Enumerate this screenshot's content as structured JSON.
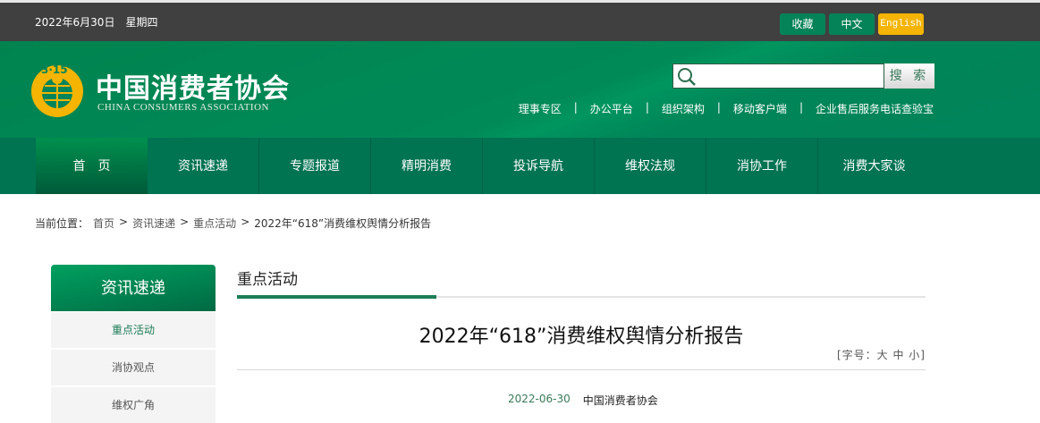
{
  "topbar": {
    "date": "2022年6月30日　星期四",
    "favorite": "收藏",
    "chinese": "中文",
    "english": "English"
  },
  "header": {
    "logo_cn": "中国消费者协会",
    "logo_en": "CHINA CONSUMERS ASSOCIATION",
    "logo_badge": "3·15",
    "search_placeholder": "",
    "search_button": "搜 索",
    "links": [
      "理事专区",
      "办公平台",
      "组织架构",
      "移动客户端",
      "企业售后服务电话查验宝"
    ]
  },
  "nav": [
    "首　页",
    "资讯速递",
    "专题报道",
    "精明消费",
    "投诉导航",
    "维权法规",
    "消协工作",
    "消费大家谈"
  ],
  "breadcrumb": {
    "label": "当前位置：",
    "items": [
      "首页",
      "资讯速递",
      "重点活动",
      "2022年“618”消费维权舆情分析报告"
    ],
    "sep": ">"
  },
  "sidebar": {
    "title": "资讯速递",
    "items": [
      "重点活动",
      "消协观点",
      "维权广角"
    ]
  },
  "article": {
    "section": "重点活动",
    "title": "2022年“618”消费维权舆情分析报告",
    "font_size": "[字号：大 中 小]",
    "date": "2022-06-30",
    "source": "中国消费者协会"
  },
  "colors": {
    "green": "#008459",
    "nav": "#007351",
    "gold": "#f4b400",
    "dark": "#404040"
  }
}
